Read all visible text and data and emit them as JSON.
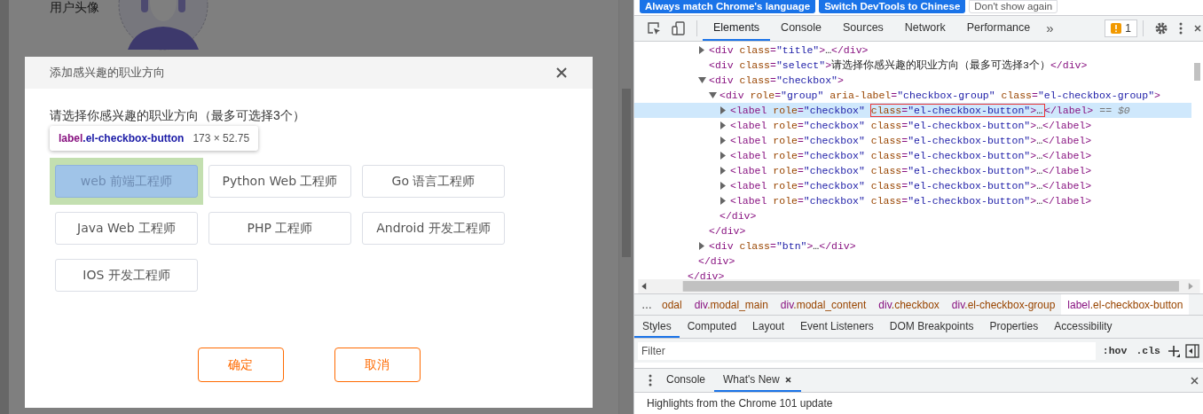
{
  "page": {
    "avatar_label": "用户头像"
  },
  "modal": {
    "title": "添加感兴趣的职业方向",
    "prompt": "请选择你感兴趣的职业方向（最多可选择3个）",
    "options": [
      {
        "label": "web 前端工程师",
        "inspected": true
      },
      {
        "label": "Python Web 工程师",
        "inspected": false
      },
      {
        "label": "Go 语言工程师",
        "inspected": false
      },
      {
        "label": "Java Web 工程师",
        "inspected": false
      },
      {
        "label": "PHP 工程师",
        "inspected": false
      },
      {
        "label": "Android 开发工程师",
        "inspected": false
      },
      {
        "label": "IOS 开发工程师",
        "inspected": false
      }
    ],
    "buttons": [
      {
        "label": "确定"
      },
      {
        "label": "取消"
      }
    ]
  },
  "inspector_tooltip": {
    "selector": "label.el-checkbox-button",
    "size": "173 × 52.75"
  },
  "devtools": {
    "infobar": {
      "buttons": [
        {
          "label": "Always match Chrome's language",
          "kind": "primary"
        },
        {
          "label": "Switch DevTools to Chinese",
          "kind": "primary"
        },
        {
          "label": "Don't show again",
          "kind": "secondary"
        }
      ]
    },
    "tabs": [
      {
        "label": "Elements",
        "selected": true
      },
      {
        "label": "Console",
        "selected": false
      },
      {
        "label": "Sources",
        "selected": false
      },
      {
        "label": "Network",
        "selected": false
      },
      {
        "label": "Performance",
        "selected": false
      }
    ],
    "more_tabs": "»",
    "issues_count": "1",
    "elements_tree": [
      {
        "close": "</div>",
        "children": [
          {
            "close": "</div>",
            "children": [
              {
                "markup": "<div class=\"title\">…</div>",
                "kind": "collapsed",
                "selected": false,
                "hovered": false
              },
              {
                "markup": "<div class=\"select\">请选择你感兴趣的职业方向（最多可选择3个）</div>",
                "kind": "leaf",
                "selected": false,
                "hovered": false
              },
              {
                "markup": "<div class=\"checkbox\">",
                "kind": "expanded",
                "selected": false,
                "hovered": false,
                "close": "</div>",
                "children": [
                  {
                    "markup": "<div role=\"group\" aria-label=\"checkbox-group\" class=\"el-checkbox-group\">",
                    "kind": "expanded",
                    "selected": false,
                    "hovered": false,
                    "close": "</div>",
                    "children": [
                      {
                        "markup": "<label role=\"checkbox\" class=\"el-checkbox-button\">…</label>",
                        "kind": "collapsed",
                        "selected": true,
                        "hovered": true,
                        "console_ref": "== $0"
                      },
                      {
                        "markup": "<label role=\"checkbox\" class=\"el-checkbox-button\">…</label>",
                        "kind": "collapsed",
                        "selected": false,
                        "hovered": false
                      },
                      {
                        "markup": "<label role=\"checkbox\" class=\"el-checkbox-button\">…</label>",
                        "kind": "collapsed",
                        "selected": false,
                        "hovered": false
                      },
                      {
                        "markup": "<label role=\"checkbox\" class=\"el-checkbox-button\">…</label>",
                        "kind": "collapsed",
                        "selected": false,
                        "hovered": false
                      },
                      {
                        "markup": "<label role=\"checkbox\" class=\"el-checkbox-button\">…</label>",
                        "kind": "collapsed",
                        "selected": false,
                        "hovered": false
                      },
                      {
                        "markup": "<label role=\"checkbox\" class=\"el-checkbox-button\">…</label>",
                        "kind": "collapsed",
                        "selected": false,
                        "hovered": false
                      },
                      {
                        "markup": "<label role=\"checkbox\" class=\"el-checkbox-button\">…</label>",
                        "kind": "collapsed",
                        "selected": false,
                        "hovered": false
                      }
                    ]
                  }
                ]
              },
              {
                "markup": "<div class=\"btn\">…</div>",
                "kind": "collapsed",
                "selected": false,
                "hovered": false
              }
            ]
          }
        ]
      }
    ],
    "breadcrumbs": {
      "more": "…",
      "items": [
        {
          "label": "odal",
          "selected": false
        },
        {
          "label": "div.modal_main",
          "selected": false
        },
        {
          "label": "div.modal_content",
          "selected": false
        },
        {
          "label": "div.checkbox",
          "selected": false
        },
        {
          "label": "div.el-checkbox-group",
          "selected": false
        },
        {
          "label": "label.el-checkbox-button",
          "selected": true
        }
      ]
    },
    "sidebar_tabs": [
      {
        "label": "Styles",
        "selected": true
      },
      {
        "label": "Computed",
        "selected": false
      },
      {
        "label": "Layout",
        "selected": false
      },
      {
        "label": "Event Listeners",
        "selected": false
      },
      {
        "label": "DOM Breakpoints",
        "selected": false
      },
      {
        "label": "Properties",
        "selected": false
      },
      {
        "label": "Accessibility",
        "selected": false
      }
    ],
    "filter": {
      "placeholder": "Filter"
    },
    "filter_buttons": [
      ":hov",
      ".cls"
    ],
    "drawer": {
      "tabs": [
        {
          "label": "Console",
          "selected": false,
          "closable": false
        },
        {
          "label": "What's New",
          "selected": true,
          "closable": true
        }
      ],
      "content": "Highlights from the Chrome 101 update"
    }
  }
}
